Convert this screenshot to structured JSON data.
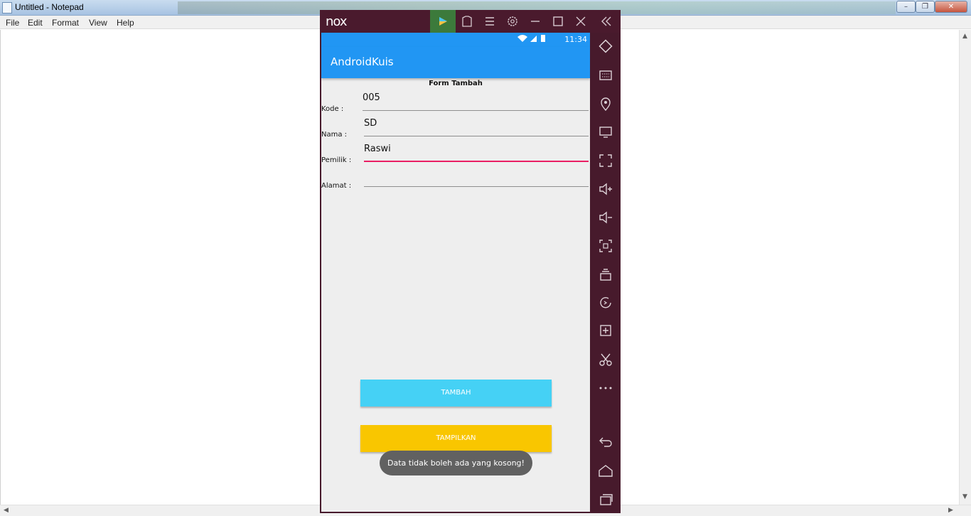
{
  "notepad": {
    "title": "Untitled - Notepad",
    "menu": [
      "File",
      "Edit",
      "Format",
      "View",
      "Help"
    ],
    "controls": {
      "minimize": "–",
      "maximize": "❐",
      "close": "✕"
    }
  },
  "nox": {
    "logo": "nox",
    "toolbar_icons": [
      "play-store",
      "shirt",
      "menu",
      "settings",
      "minimize",
      "maximize",
      "close",
      "collapse"
    ],
    "status_time": "11:34",
    "side_icons": [
      "rotate",
      "keyboard",
      "location",
      "screen",
      "fullscreen",
      "volume-up",
      "volume-down",
      "screenshot",
      "multi-instance",
      "refresh",
      "add-apk",
      "scissors",
      "more",
      "back",
      "home",
      "recent"
    ]
  },
  "app": {
    "title": "AndroidKuis",
    "form_title": "Form Tambah",
    "fields": [
      {
        "label": "Kode  :",
        "value": "005"
      },
      {
        "label": "Nama :",
        "value": "SD"
      },
      {
        "label": "Pemilik :",
        "value": "Raswi"
      },
      {
        "label": "Alamat :",
        "value": ""
      }
    ],
    "btn_tambah": "TAMBAH",
    "btn_tampilkan": "TAMPILKAN",
    "toast": "Data tidak boleh ada yang kosong!"
  },
  "colors": {
    "primary": "#2196f3",
    "accent": "#e91e63",
    "tambah": "#45d1f5",
    "tampilkan": "#f9c600",
    "nox_frame": "#471a2c"
  }
}
